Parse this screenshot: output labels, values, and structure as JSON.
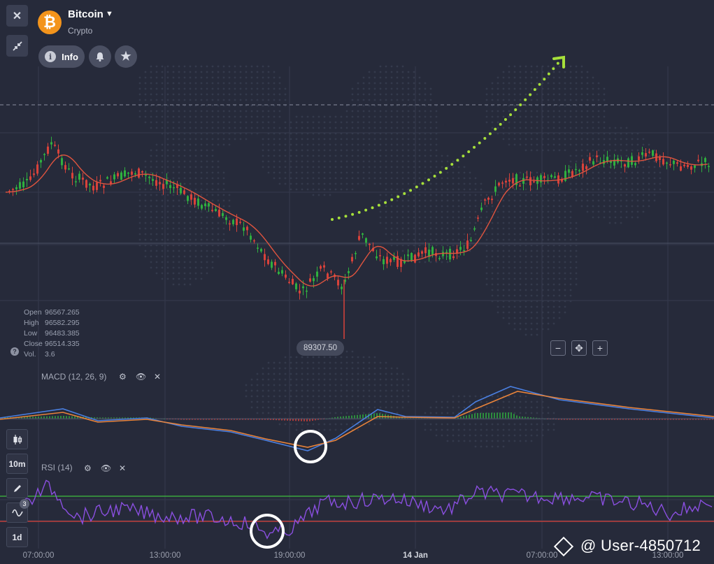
{
  "asset": {
    "name": "Bitcoin",
    "category": "Crypto",
    "icon": "bitcoin-icon",
    "icon_glyph": "₿"
  },
  "toolbar": {
    "close_icon": "close-icon",
    "collapse_icon": "collapse-icon",
    "info_label": "Info",
    "bell_icon": "bell-icon",
    "star_icon": "star-icon"
  },
  "ohlc": [
    {
      "key": "Open",
      "value": "96567.265"
    },
    {
      "key": "High",
      "value": "96582.295"
    },
    {
      "key": "Low",
      "value": "96483.385"
    },
    {
      "key": "Close",
      "value": "96514.335"
    },
    {
      "key": "Vol.",
      "value": "3.6"
    }
  ],
  "low_price_tag": "89307.50",
  "zoom": {
    "minus": "−",
    "center": "✥",
    "plus": "+"
  },
  "macd": {
    "label": "MACD (12, 26, 9)"
  },
  "rsi": {
    "label": "RSI (14)"
  },
  "sidebar": {
    "chart_type_icon": "candles-icon",
    "timeframe": "10m",
    "draw_icon": "pencil-icon",
    "indicators_icon": "wave-icon",
    "indicators_count": "3",
    "period": "1d"
  },
  "x_axis": [
    "07:00:00",
    "13:00:00",
    "19:00:00",
    "14 Jan",
    "07:00:00",
    "13:00:00"
  ],
  "watermark": "@ User-4850712",
  "colors": {
    "background": "#262a3a",
    "candle_up": "#2fb03f",
    "candle_down": "#d9423a",
    "ma_line": "#e0543f",
    "macd_line": "#4a7fe0",
    "signal_line": "#e8833a",
    "rsi_line": "#8a4fe0",
    "rsi_upper": "#3fbf3f",
    "rsi_lower": "#d9423a",
    "arrow": "#a6e03a",
    "bitcoin": "#f3941c"
  }
}
